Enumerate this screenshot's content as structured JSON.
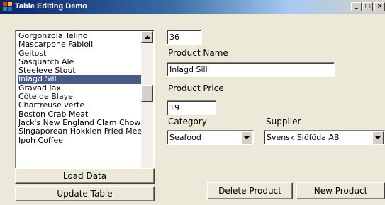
{
  "window": {
    "title": "Table Editing Demo",
    "minimize_glyph": "_",
    "maximize_glyph": "□",
    "close_glyph": "×"
  },
  "product_list": {
    "items": [
      "Gorgonzola Telino",
      "Mascarpone Fabioli",
      "Geitost",
      "Sasquatch Ale",
      "Steeleye Stout",
      "Inlagd Sill",
      "Gravad lax",
      "Côte de Blaye",
      "Chartreuse verte",
      "Boston Crab Meat",
      "Jack's New England Clam Chowder",
      "Singaporean Hokkien Fried Mee",
      "Ipoh Coffee"
    ],
    "selected_index": 5
  },
  "buttons": {
    "load_data": "Load Data",
    "update_table": "Update Table",
    "delete_product": "Delete Product",
    "new_product": "New Product"
  },
  "form": {
    "product_id": "36",
    "product_name_label": "Product Name",
    "product_name": "Inlagd Sill",
    "product_price_label": "Product Price",
    "product_price": "19",
    "category_label": "Category",
    "category": "Seafood",
    "supplier_label": "Supplier",
    "supplier": "Svensk Sjöföda AB"
  },
  "colors": {
    "window_face": "#ece9d8",
    "selection": "#4a5a86",
    "titlebar_start": "#0a246a"
  },
  "icons": {
    "app": "app-grid-icon",
    "scroll_up": "triangle-up-icon",
    "scroll_down": "triangle-down-icon",
    "combo": "triangle-down-icon"
  }
}
